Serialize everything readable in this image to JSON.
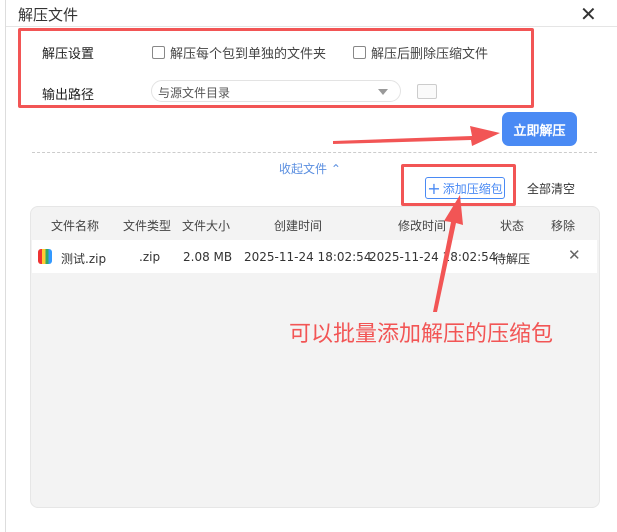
{
  "dialog": {
    "title": "解压文件",
    "close_icon": "close-icon"
  },
  "settings": {
    "label": "解压设置",
    "option1": "解压每个包到单独的文件夹",
    "option2": "解压后删除压缩文件",
    "option1_checked": false,
    "option2_checked": false
  },
  "output": {
    "label": "输出路径",
    "value": "与源文件目录"
  },
  "actions": {
    "extract_now": "立即解压",
    "collapse": "收起文件 ⌃",
    "add": "添加压缩包",
    "clear_all": "全部清空"
  },
  "table": {
    "headers": [
      "文件名称",
      "文件类型",
      "文件大小",
      "创建时间",
      "修改时间",
      "状态",
      "移除"
    ],
    "rows": [
      {
        "name": "测试.zip",
        "type": ".zip",
        "size": "2.08 MB",
        "created": "2025-11-24 18:02:54",
        "modified": "2025-11-24 18:02:54",
        "status": "待解压"
      }
    ]
  },
  "annotation": {
    "text": "可以批量添加解压的压缩包",
    "color": "#f25555"
  },
  "colors": {
    "accent": "#4a8af4",
    "highlight": "#f25555"
  }
}
